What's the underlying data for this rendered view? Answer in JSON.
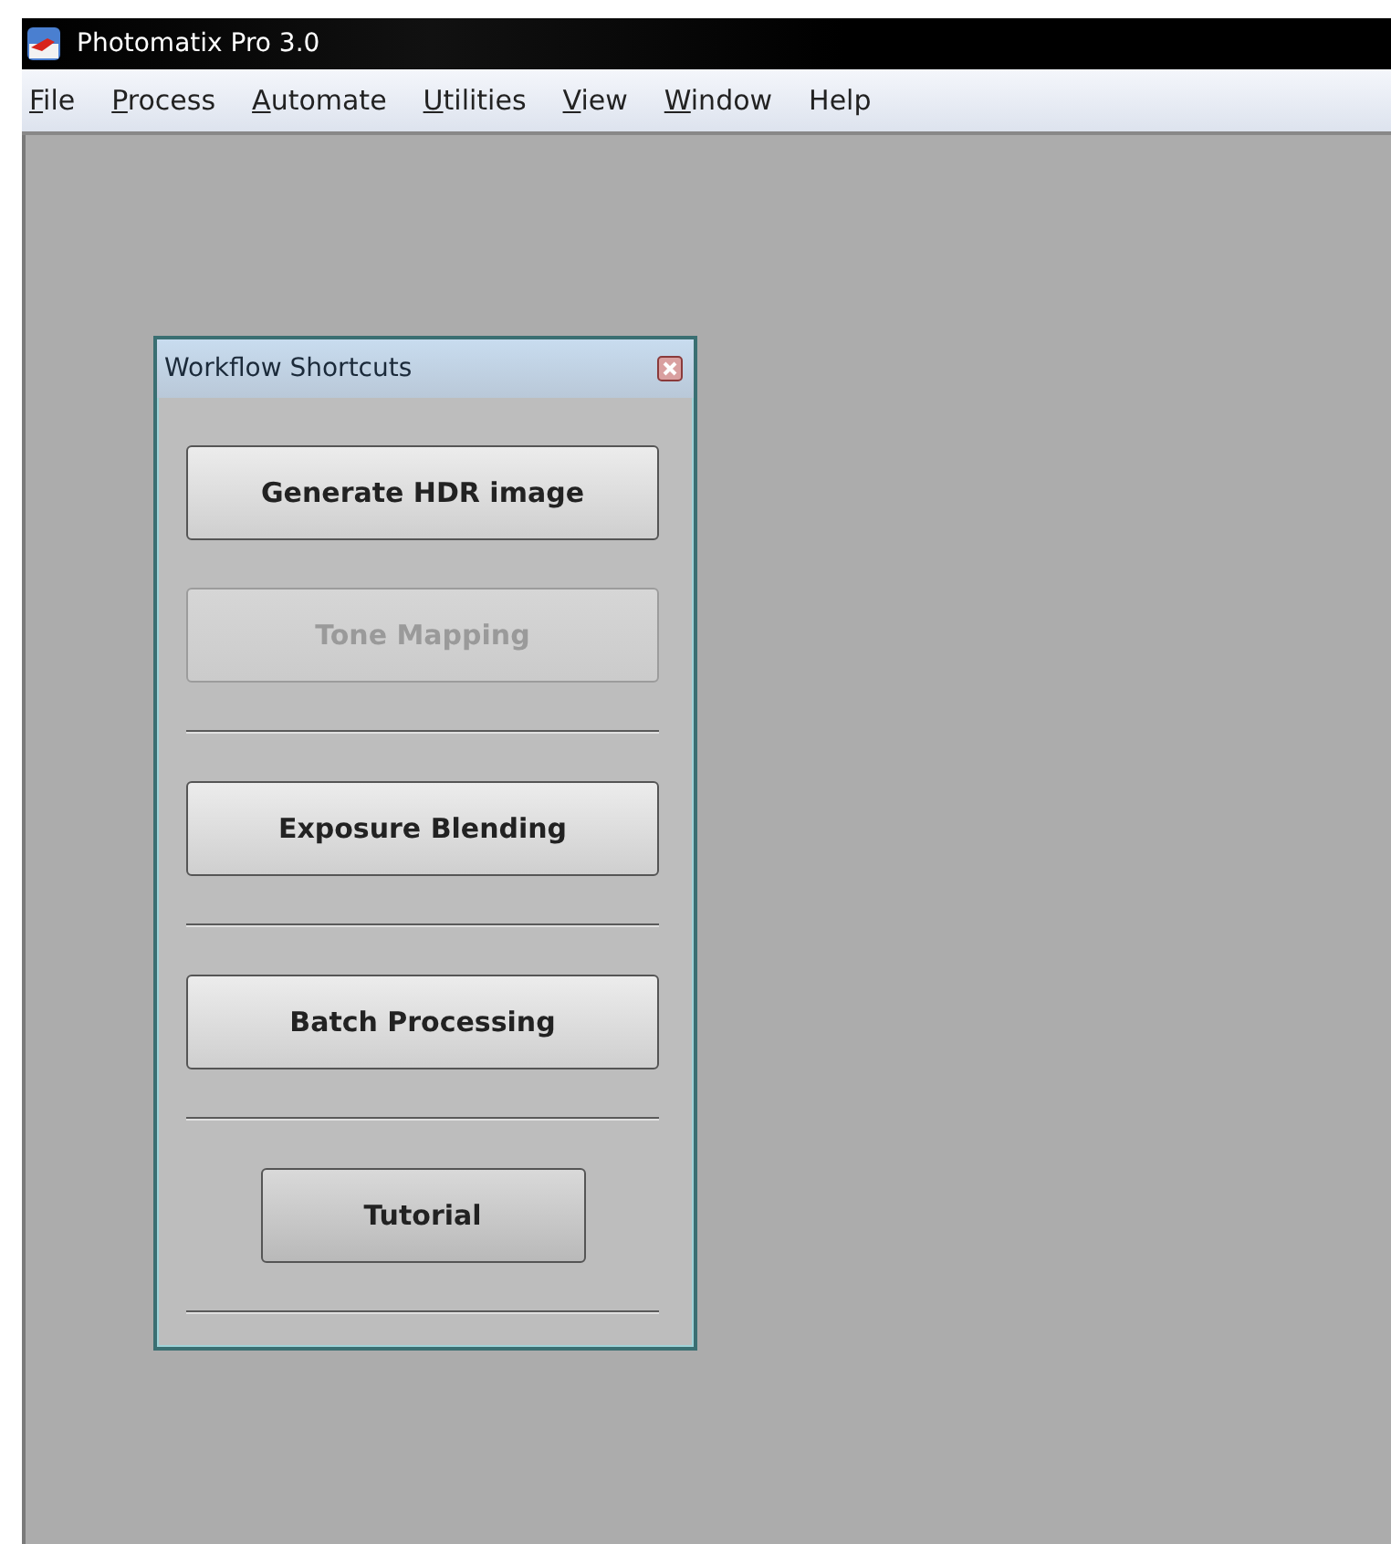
{
  "window": {
    "title": "Photomatix Pro 3.0"
  },
  "menu": [
    {
      "label": "File",
      "underlined": true
    },
    {
      "label": "Process",
      "underlined": true
    },
    {
      "label": "Automate",
      "underlined": true
    },
    {
      "label": "Utilities",
      "underlined": true
    },
    {
      "label": "View",
      "underlined": true
    },
    {
      "label": "Window",
      "underlined": true
    },
    {
      "label": "Help",
      "underlined": false
    }
  ],
  "panel": {
    "title": "Workflow Shortcuts",
    "items": [
      {
        "kind": "button",
        "label": "Generate HDR image",
        "disabled": false
      },
      {
        "kind": "button",
        "label": "Tone Mapping",
        "disabled": true
      },
      {
        "kind": "separator"
      },
      {
        "kind": "button",
        "label": "Exposure Blending",
        "disabled": false
      },
      {
        "kind": "separator"
      },
      {
        "kind": "button",
        "label": "Batch Processing",
        "disabled": false
      },
      {
        "kind": "separator"
      },
      {
        "kind": "small-button",
        "label": "Tutorial",
        "disabled": false
      },
      {
        "kind": "separator"
      }
    ]
  }
}
